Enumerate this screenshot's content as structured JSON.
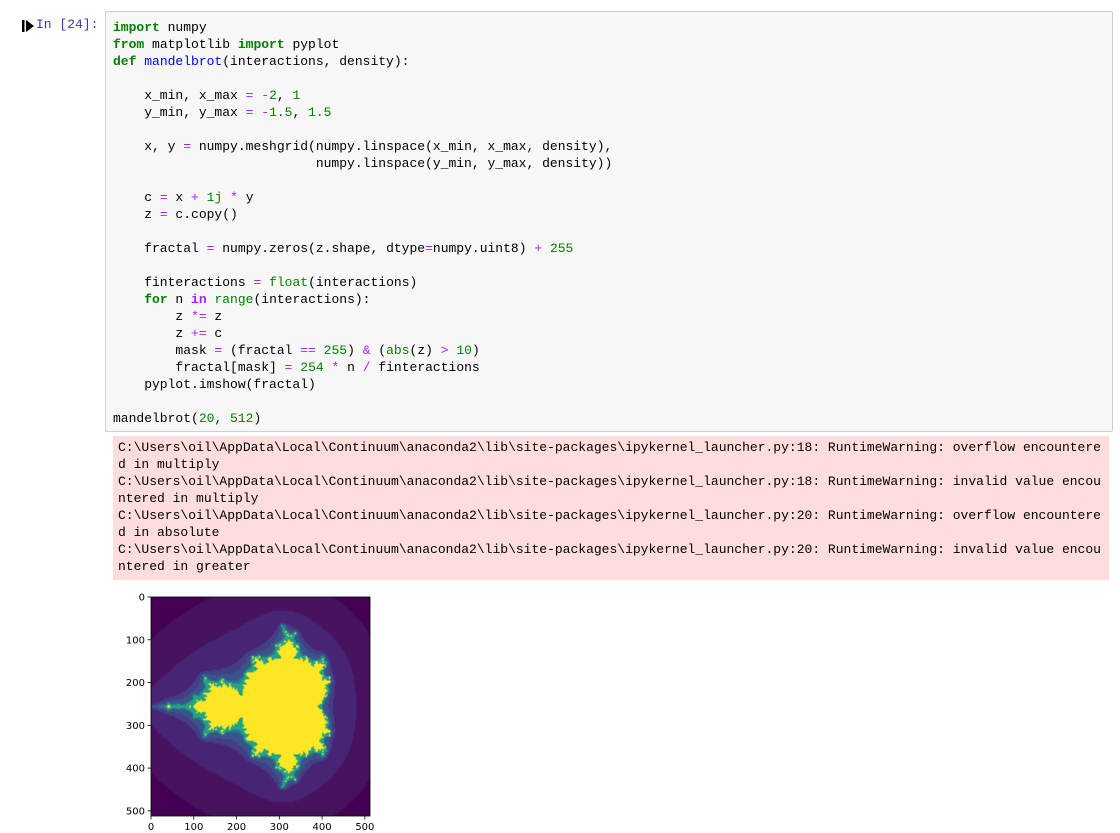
{
  "cell": {
    "prompt": "In [24]:",
    "code_lines": [
      [
        [
          "k",
          "import"
        ],
        [
          "t",
          " numpy"
        ]
      ],
      [
        [
          "k",
          "from"
        ],
        [
          "t",
          " matplotlib "
        ],
        [
          "k",
          "import"
        ],
        [
          "t",
          " pyplot"
        ]
      ],
      [
        [
          "k",
          "def"
        ],
        [
          "t",
          " "
        ],
        [
          "nf",
          "mandelbrot"
        ],
        [
          "t",
          "(interactions, density):"
        ]
      ],
      [],
      [
        [
          "t",
          "    x_min, x_max "
        ],
        [
          "o",
          "="
        ],
        [
          "t",
          " "
        ],
        [
          "o",
          "-"
        ],
        [
          "m",
          "2"
        ],
        [
          "t",
          ", "
        ],
        [
          "m",
          "1"
        ]
      ],
      [
        [
          "t",
          "    y_min, y_max "
        ],
        [
          "o",
          "="
        ],
        [
          "t",
          " "
        ],
        [
          "o",
          "-"
        ],
        [
          "m",
          "1.5"
        ],
        [
          "t",
          ", "
        ],
        [
          "m",
          "1.5"
        ]
      ],
      [],
      [
        [
          "t",
          "    x, y "
        ],
        [
          "o",
          "="
        ],
        [
          "t",
          " numpy.meshgrid(numpy.linspace(x_min, x_max, density),"
        ]
      ],
      [
        [
          "t",
          "                          numpy.linspace(y_min, y_max, density))"
        ]
      ],
      [],
      [
        [
          "t",
          "    c "
        ],
        [
          "o",
          "="
        ],
        [
          "t",
          " x "
        ],
        [
          "o",
          "+"
        ],
        [
          "t",
          " "
        ],
        [
          "m",
          "1j"
        ],
        [
          "t",
          " "
        ],
        [
          "o",
          "*"
        ],
        [
          "t",
          " y"
        ]
      ],
      [
        [
          "t",
          "    z "
        ],
        [
          "o",
          "="
        ],
        [
          "t",
          " c.copy()"
        ]
      ],
      [],
      [
        [
          "t",
          "    fractal "
        ],
        [
          "o",
          "="
        ],
        [
          "t",
          " numpy.zeros(z.shape, dtype"
        ],
        [
          "o",
          "="
        ],
        [
          "t",
          "numpy.uint8) "
        ],
        [
          "o",
          "+"
        ],
        [
          "t",
          " "
        ],
        [
          "m",
          "255"
        ]
      ],
      [],
      [
        [
          "t",
          "    finteractions "
        ],
        [
          "o",
          "="
        ],
        [
          "t",
          " "
        ],
        [
          "nb",
          "float"
        ],
        [
          "t",
          "(interactions)"
        ]
      ],
      [
        [
          "t",
          "    "
        ],
        [
          "k",
          "for"
        ],
        [
          "t",
          " n "
        ],
        [
          "ow",
          "in"
        ],
        [
          "t",
          " "
        ],
        [
          "nb",
          "range"
        ],
        [
          "t",
          "(interactions):"
        ]
      ],
      [
        [
          "t",
          "        z "
        ],
        [
          "o",
          "*="
        ],
        [
          "t",
          " z"
        ]
      ],
      [
        [
          "t",
          "        z "
        ],
        [
          "o",
          "+="
        ],
        [
          "t",
          " c"
        ]
      ],
      [
        [
          "t",
          "        mask "
        ],
        [
          "o",
          "="
        ],
        [
          "t",
          " (fractal "
        ],
        [
          "o",
          "=="
        ],
        [
          "t",
          " "
        ],
        [
          "m",
          "255"
        ],
        [
          "t",
          ") "
        ],
        [
          "o",
          "&"
        ],
        [
          "t",
          " ("
        ],
        [
          "nb",
          "abs"
        ],
        [
          "t",
          "(z) "
        ],
        [
          "o",
          ">"
        ],
        [
          "t",
          " "
        ],
        [
          "m",
          "10"
        ],
        [
          "t",
          ")"
        ]
      ],
      [
        [
          "t",
          "        fractal[mask] "
        ],
        [
          "o",
          "="
        ],
        [
          "t",
          " "
        ],
        [
          "m",
          "254"
        ],
        [
          "t",
          " "
        ],
        [
          "o",
          "*"
        ],
        [
          "t",
          " n "
        ],
        [
          "o",
          "/"
        ],
        [
          "t",
          " finteractions"
        ]
      ],
      [
        [
          "t",
          "    pyplot.imshow(fractal)"
        ]
      ],
      [],
      [
        [
          "t",
          "mandelbrot("
        ],
        [
          "m",
          "20"
        ],
        [
          "t",
          ", "
        ],
        [
          "m",
          "512"
        ],
        [
          "t",
          ")"
        ]
      ]
    ]
  },
  "stderr": {
    "text": "C:\\Users\\oil\\AppData\\Local\\Continuum\\anaconda2\\lib\\site-packages\\ipykernel_launcher.py:18: RuntimeWarning: overflow encountered in multiply\nC:\\Users\\oil\\AppData\\Local\\Continuum\\anaconda2\\lib\\site-packages\\ipykernel_launcher.py:18: RuntimeWarning: invalid value encountered in multiply\nC:\\Users\\oil\\AppData\\Local\\Continuum\\anaconda2\\lib\\site-packages\\ipykernel_launcher.py:20: RuntimeWarning: overflow encountered in absolute\nC:\\Users\\oil\\AppData\\Local\\Continuum\\anaconda2\\lib\\site-packages\\ipykernel_launcher.py:20: RuntimeWarning: invalid value encountered in greater"
  },
  "plot": {
    "x_ticks": [
      "0",
      "100",
      "200",
      "300",
      "400",
      "500"
    ],
    "y_ticks": [
      "0",
      "100",
      "200",
      "300",
      "400",
      "500"
    ],
    "colormap_levels": [
      "#440154",
      "#47135f",
      "#482475",
      "#433e85",
      "#3a538b",
      "#2d708e",
      "#20a386",
      "#fde725"
    ],
    "image_size": 512,
    "iterations": 20,
    "x_range": [
      -2,
      1
    ],
    "y_range": [
      -1.5,
      1.5
    ]
  },
  "colors": {
    "prompt": "#303f9f",
    "stderr_bg": "#ffdddd",
    "code_bg": "#f7f7f7"
  }
}
